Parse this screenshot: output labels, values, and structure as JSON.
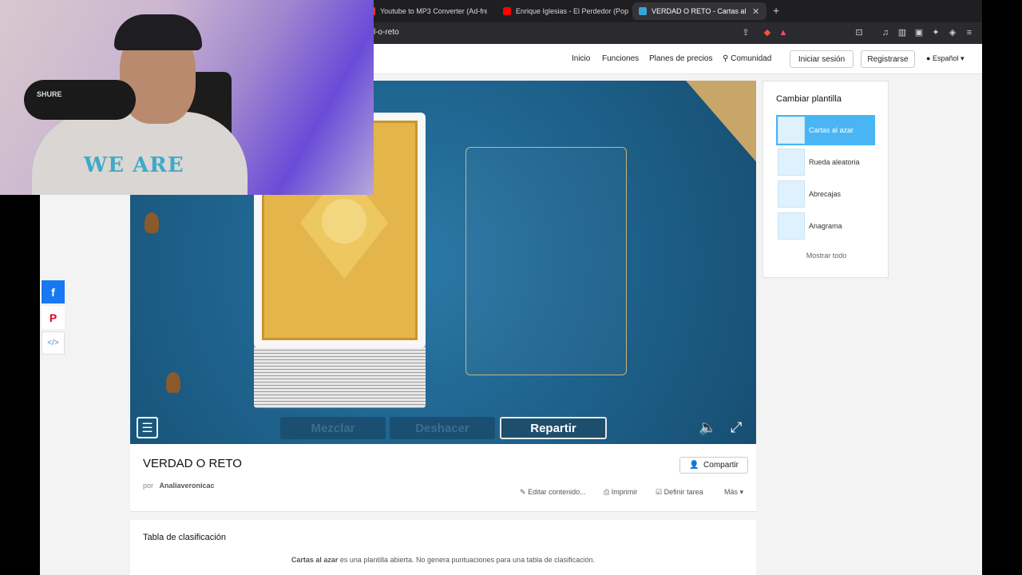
{
  "browser": {
    "tabs": [
      {
        "title": "Youtube to MP3 Converter (Ad-fre",
        "favicon_color": "#e53b2c"
      },
      {
        "title": "Enrique Iglesias - El Perdedor (Pop",
        "favicon_color": "#ff0000"
      },
      {
        "title": "VERDAD O RETO - Cartas al a",
        "favicon_color": "#37a5d8",
        "active": true
      }
    ],
    "url_fragment": "l-o-reto"
  },
  "header": {
    "nav": [
      "Inicio",
      "Funciones",
      "Planes de precios",
      "Comunidad"
    ],
    "login": "Iniciar sesión",
    "signup": "Registrarse",
    "language": "Español"
  },
  "game": {
    "buttons": {
      "shuffle": "Mezclar",
      "undo": "Deshacer",
      "deal": "Repartir"
    }
  },
  "activity": {
    "title": "VERDAD O RETO",
    "by_prefix": "por",
    "author": "Analiaveronicac",
    "share": "Compartir",
    "actions": {
      "edit": "Editar contenido...",
      "print": "Imprimir",
      "assign": "Definir tarea",
      "more": "Más"
    }
  },
  "leaderboard": {
    "title": "Tabla de clasificación",
    "note_bold": "Cartas al azar",
    "note_rest": " es una plantilla abierta. No genera puntuaciones para una tabla de clasificación."
  },
  "templates": {
    "title": "Cambiar plantilla",
    "items": [
      {
        "label": "Cartas al azar",
        "selected": true
      },
      {
        "label": "Rueda aleatoria"
      },
      {
        "label": "Abrecajas"
      },
      {
        "label": "Anagrama"
      }
    ],
    "show_all": "Mostrar todo"
  },
  "webcam": {
    "shirt_text": "WE ARE",
    "mic_brand": "SHURE"
  },
  "colors": {
    "accent": "#4ab5f5",
    "game_bg": "#1e5f86",
    "facebook": "#1877f2",
    "pinterest": "#e60023"
  }
}
